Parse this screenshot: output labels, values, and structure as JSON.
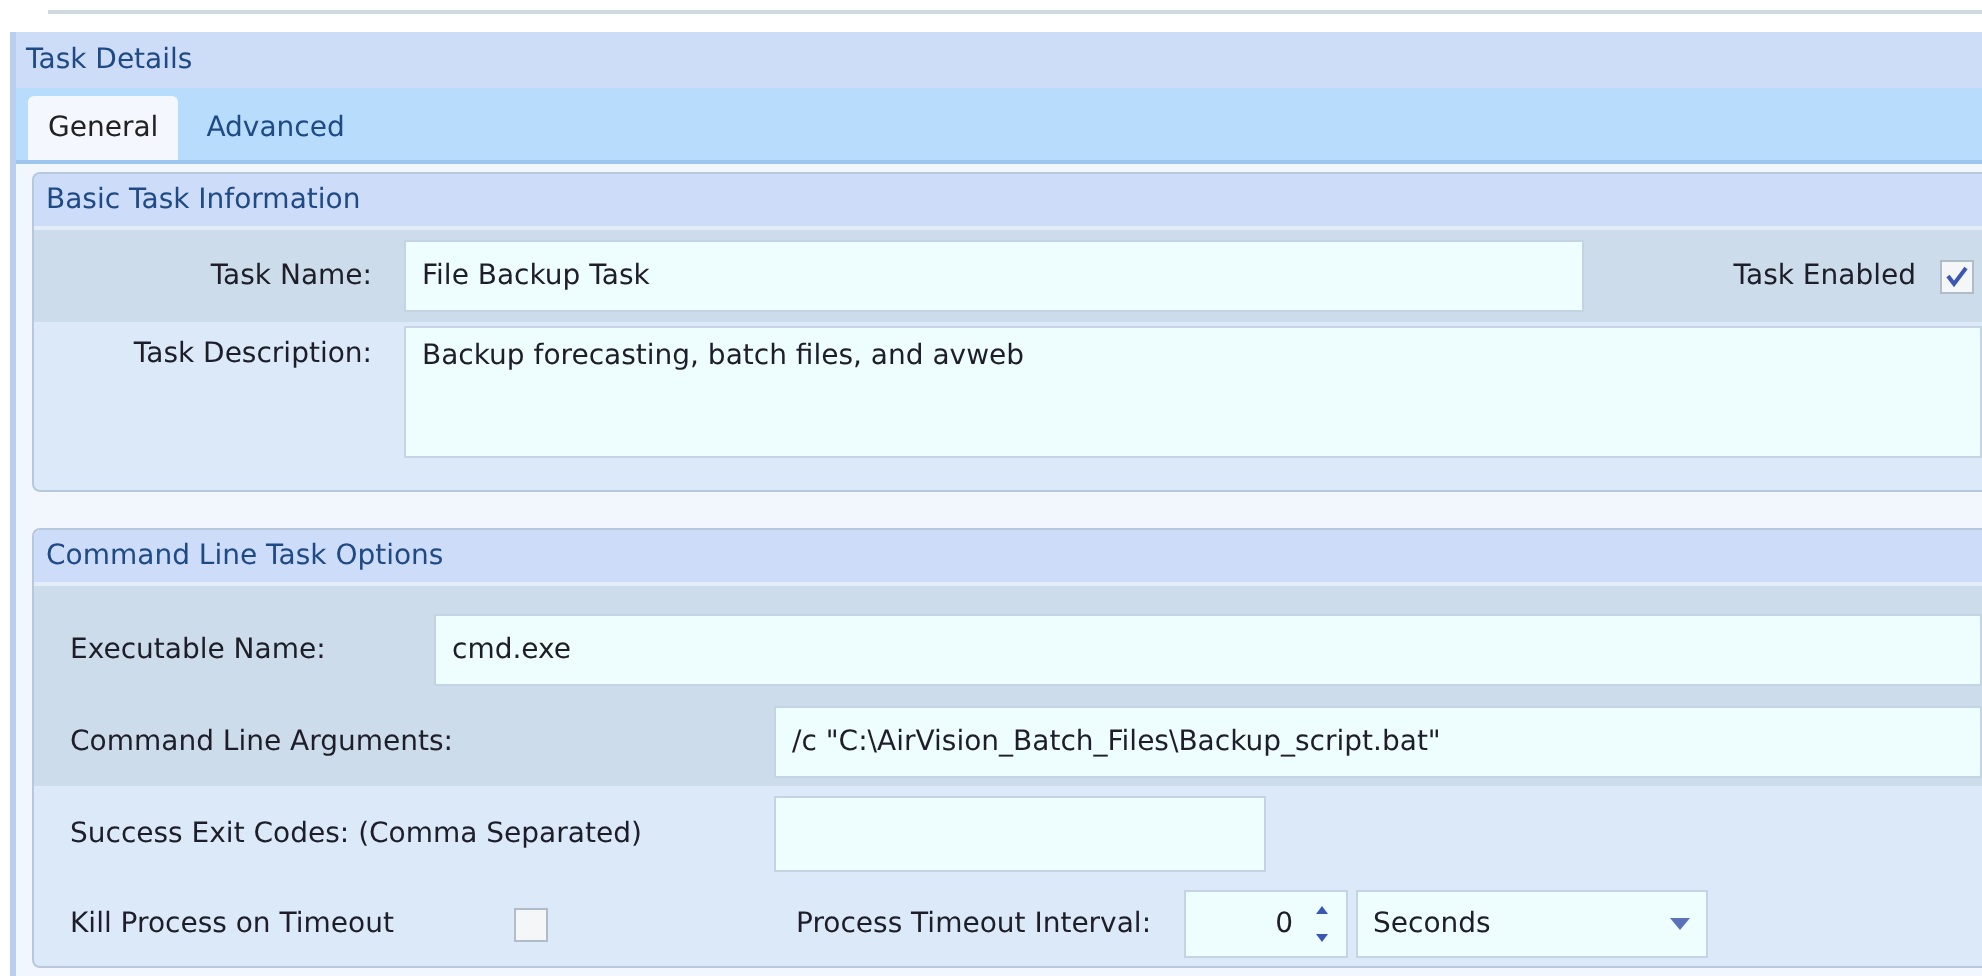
{
  "panel": {
    "title": "Task Details"
  },
  "tabs": [
    {
      "label": "General",
      "selected": true
    },
    {
      "label": "Advanced",
      "selected": false
    }
  ],
  "basic": {
    "title": "Basic Task Information",
    "task_name": {
      "label": "Task Name:",
      "value": "File Backup Task"
    },
    "task_enabled": {
      "label": "Task Enabled",
      "checked": true
    },
    "task_description": {
      "label": "Task Description:",
      "value": "Backup forecasting, batch files, and avweb"
    }
  },
  "command": {
    "title": "Command Line Task Options",
    "executable": {
      "label": "Executable Name:",
      "value": "cmd.exe"
    },
    "arguments": {
      "label": "Command Line Arguments:",
      "value": "/c \"C:\\AirVision_Batch_Files\\Backup_script.bat\""
    },
    "exit_codes": {
      "label": "Success Exit Codes: (Comma Separated)"
    },
    "kill_on_timeout": {
      "label": "Kill Process on Timeout",
      "checked": false
    },
    "timeout": {
      "label": "Process Timeout Interval:",
      "value": "0",
      "unit": "Seconds"
    }
  }
}
